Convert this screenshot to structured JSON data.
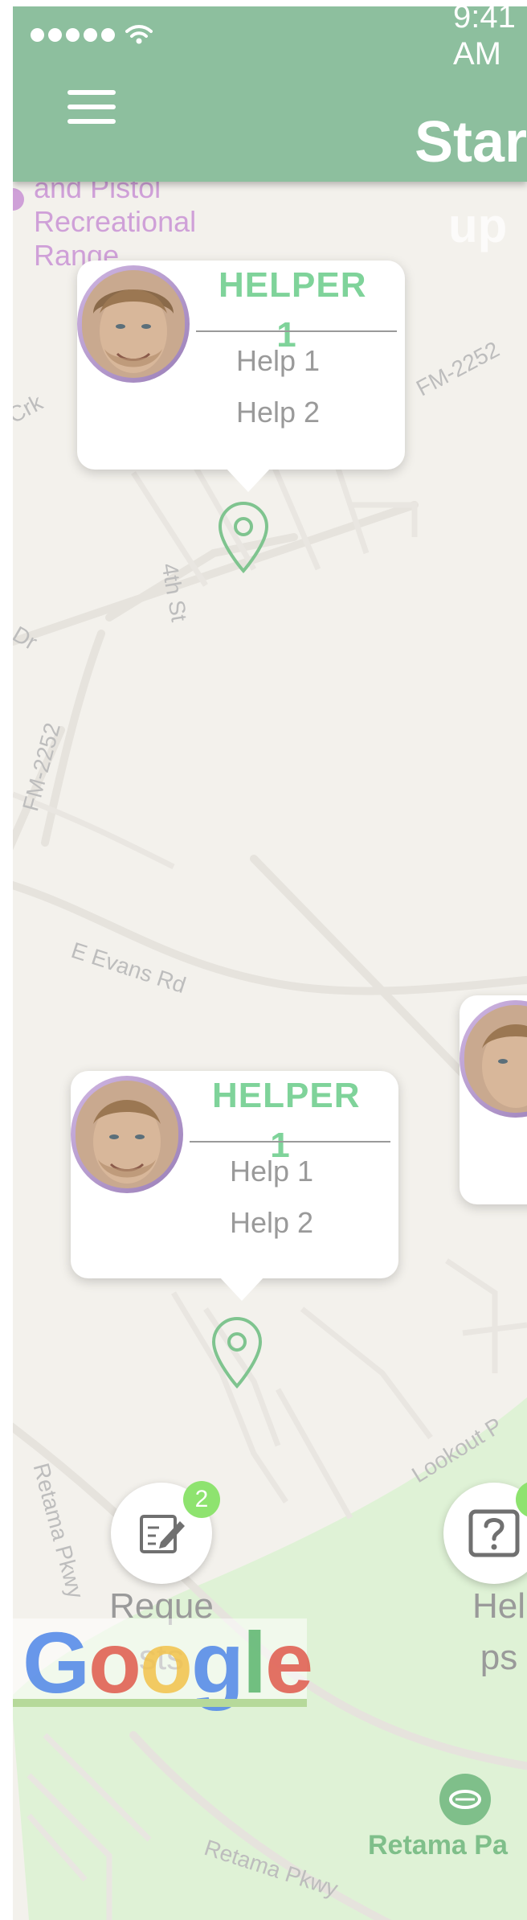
{
  "status_bar": {
    "time": "9:41 AM"
  },
  "header": {
    "title": "Star",
    "title_ghost": "up"
  },
  "map": {
    "poi_label": "and Pistol\nRecreational\nRange",
    "streets": {
      "crk": "Crk",
      "fm2252_top": "FM-2252",
      "fourth_st": "4th St",
      "dr": "Dr",
      "fm2252_left": "FM-2252",
      "evans": "E Evans Rd",
      "lookout": "Lookout P",
      "retama_left": "Retama Pkwy",
      "retama_bottom": "Retama Pkwy"
    },
    "park_label": "Retama Pa"
  },
  "cards": [
    {
      "name": "HELPER 1",
      "items": [
        "Help 1",
        "Help 2"
      ]
    },
    {
      "name": "HELPER 1",
      "items": [
        "Help 1",
        "Help 2"
      ]
    }
  ],
  "actions": {
    "requests": {
      "label": "Requests",
      "badge": "2"
    },
    "helps": {
      "label": "Helps"
    }
  },
  "logo": {
    "text": "Google"
  },
  "colors": {
    "header": "#8dbf9e",
    "accent_green": "#7fd39a",
    "badge_green": "#8ee36f",
    "park": "#dff2d6",
    "poi": "#cfa0d8"
  },
  "icons": [
    "menu-icon",
    "map-pin-icon",
    "edit-icon",
    "help-question-icon",
    "park-icon",
    "wifi-icon"
  ]
}
